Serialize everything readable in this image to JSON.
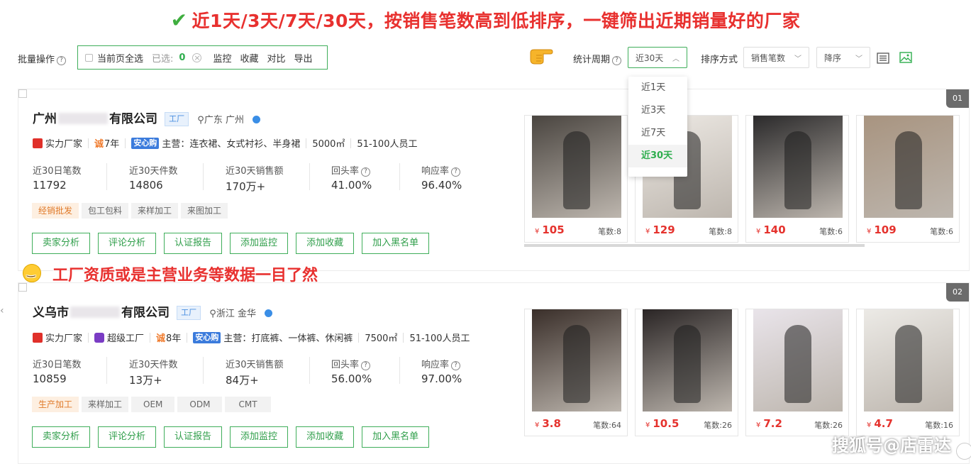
{
  "banner": {
    "check": "✔",
    "text": "近1天/3天/7天/30天，按销售笔数高到低排序，一键筛出近期销量好的厂家"
  },
  "toolbar": {
    "batch_label": "批量操作",
    "select_all": "当前页全选",
    "selected_label": "已选:",
    "selected_count": "0",
    "actions": [
      "监控",
      "收藏",
      "对比",
      "导出"
    ],
    "period_label": "统计周期",
    "period_value": "近30天",
    "sort_label": "排序方式",
    "sort_value": "销售笔数",
    "order_value": "降序"
  },
  "period_options": [
    "近1天",
    "近3天",
    "近7天",
    "近30天"
  ],
  "period_selected": "近30天",
  "note": "工厂资质或是主营业务等数据一目了然",
  "watermark": "搜狐号@店雷达",
  "cards": [
    {
      "rank": "01",
      "name_prefix": "广州",
      "name_suffix": "有限公司",
      "factory_tag": "工厂",
      "location": "广东 广州",
      "badge_strength": "实力厂家",
      "badge_super": "",
      "cheng": "诚",
      "years": "7年",
      "xin": "安心购",
      "main_business": "主营：连衣裙、女式衬衫、半身裙",
      "area": "5000㎡",
      "staff": "51-100人员工",
      "stats": [
        {
          "label": "近30日笔数",
          "value": "11792"
        },
        {
          "label": "近30天件数",
          "value": "14806"
        },
        {
          "label": "近30天销售额",
          "value": "170万+"
        },
        {
          "label": "回头率",
          "value": "41.00%"
        },
        {
          "label": "响应率",
          "value": "96.40%"
        }
      ],
      "tags": [
        "经销批发",
        "包工包料",
        "来样加工",
        "来图加工"
      ],
      "buttons": [
        "卖家分析",
        "评论分析",
        "认证报告",
        "添加监控",
        "添加收藏",
        "加入黑名单"
      ],
      "products": [
        {
          "currency": "¥",
          "price": "105",
          "count": "笔数:8"
        },
        {
          "currency": "¥",
          "price": "129",
          "count": "笔数:8"
        },
        {
          "currency": "¥",
          "price": "140",
          "count": "笔数:6"
        },
        {
          "currency": "¥",
          "price": "109",
          "count": "笔数:6"
        }
      ]
    },
    {
      "rank": "02",
      "name_prefix": "义乌市",
      "name_suffix": "有限公司",
      "factory_tag": "工厂",
      "location": "浙江 金华",
      "badge_strength": "实力厂家",
      "badge_super": "超级工厂",
      "cheng": "诚",
      "years": "8年",
      "xin": "安心购",
      "main_business": "主营：打底裤、一体裤、休闲裤",
      "area": "7500㎡",
      "staff": "51-100人员工",
      "stats": [
        {
          "label": "近30日笔数",
          "value": "10859"
        },
        {
          "label": "近30天件数",
          "value": "13万+"
        },
        {
          "label": "近30天销售额",
          "value": "84万+"
        },
        {
          "label": "回头率",
          "value": "56.00%"
        },
        {
          "label": "响应率",
          "value": "97.00%"
        }
      ],
      "tags": [
        "生产加工",
        "来样加工",
        "OEM",
        "ODM",
        "CMT"
      ],
      "buttons": [
        "卖家分析",
        "评论分析",
        "认证报告",
        "添加监控",
        "添加收藏",
        "加入黑名单"
      ],
      "products": [
        {
          "currency": "¥",
          "price": "3.8",
          "count": "笔数:64"
        },
        {
          "currency": "¥",
          "price": "10.5",
          "count": "笔数:26"
        },
        {
          "currency": "¥",
          "price": "7.2",
          "count": "笔数:26"
        },
        {
          "currency": "¥",
          "price": "4.7",
          "count": "笔数:16"
        }
      ]
    }
  ],
  "product_images": [
    [
      "#4a4540",
      "#ede9e4",
      "#2b2a2b",
      "#a89480"
    ],
    [
      "#3a2f2a",
      "#2a2525",
      "#e9e4ea",
      "#eceae6"
    ]
  ]
}
